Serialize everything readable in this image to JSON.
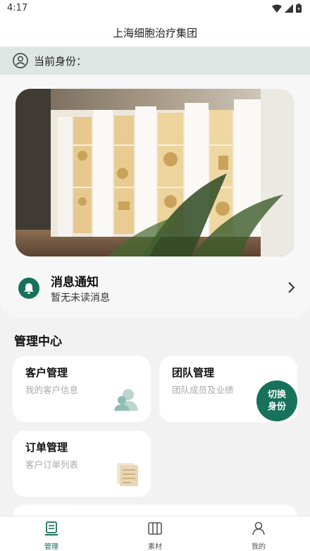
{
  "status": {
    "time": "4:17"
  },
  "header": {
    "title": "上海细胞治疗集团"
  },
  "identity": {
    "label": "当前身份："
  },
  "notice": {
    "title": "消息通知",
    "subtitle": "暂无未读消息"
  },
  "management": {
    "section_title": "管理中心",
    "tiles": [
      {
        "title": "客户管理",
        "subtitle": "我的客户信息",
        "icon": "customer-icon"
      },
      {
        "title": "团队管理",
        "subtitle": "团队成员及业绩",
        "icon": "team-icon"
      },
      {
        "title": "订单管理",
        "subtitle": "客户订单列表",
        "icon": "order-list-icon"
      }
    ],
    "switch_button": {
      "line1": "切换",
      "line2": "身份"
    }
  },
  "tabbar": {
    "items": [
      {
        "label": "管理",
        "icon": "manage-icon",
        "active": true
      },
      {
        "label": "素材",
        "icon": "material-icon",
        "active": false
      },
      {
        "label": "我的",
        "icon": "profile-icon",
        "active": false
      }
    ]
  },
  "colors": {
    "accent": "#17715b",
    "identity_bg": "#dde6e3"
  }
}
